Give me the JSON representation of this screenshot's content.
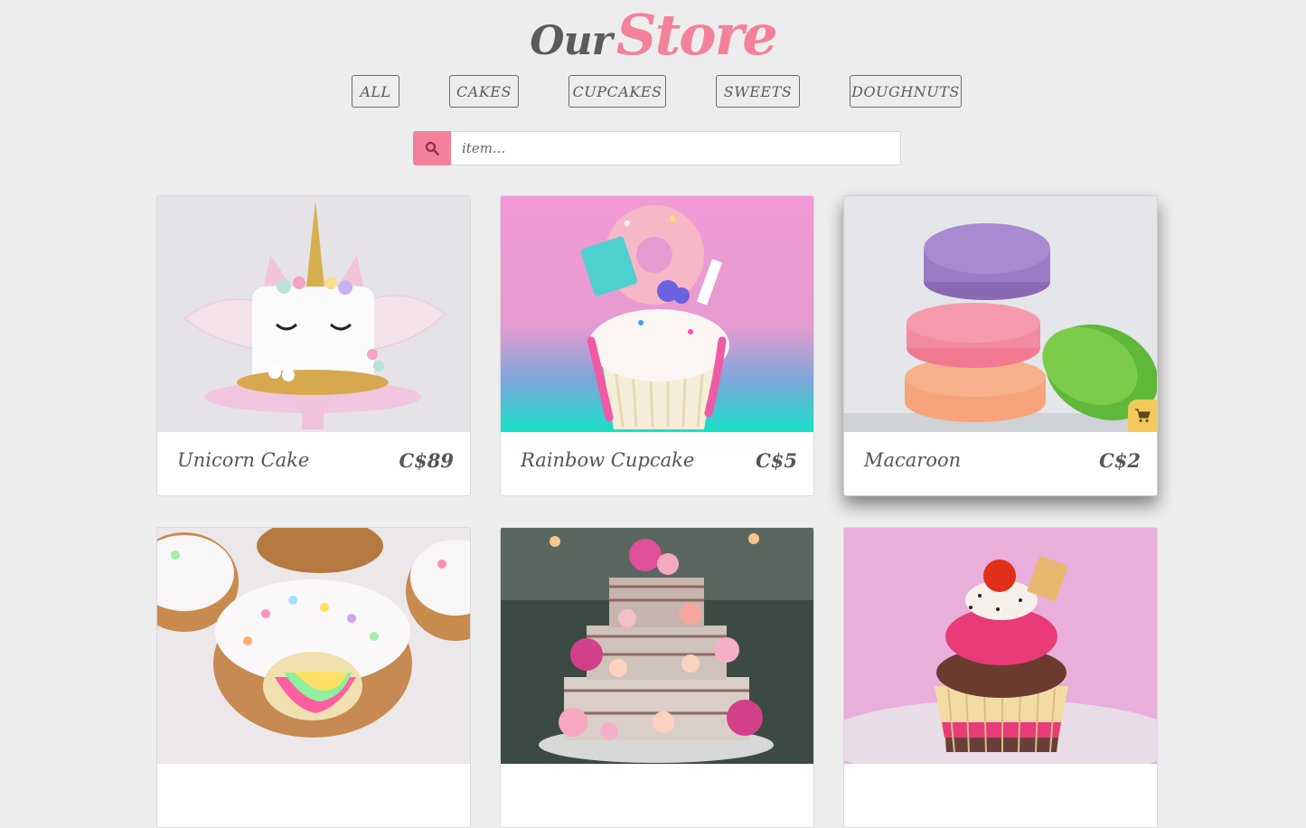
{
  "header": {
    "title_our": "Our",
    "title_store": "Store"
  },
  "filters": [
    {
      "label": "ALL"
    },
    {
      "label": "CAKES"
    },
    {
      "label": "CUPCAKES"
    },
    {
      "label": "SWEETS"
    },
    {
      "label": "DOUGHNUTS"
    }
  ],
  "search": {
    "placeholder": "item...",
    "icon": "search-icon"
  },
  "products": [
    {
      "name": "Unicorn Cake",
      "price": "C$89"
    },
    {
      "name": "Rainbow Cupcake",
      "price": "C$5"
    },
    {
      "name": "Macaroon",
      "price": "C$2",
      "cart_icon": "cart-icon"
    },
    {
      "name": "",
      "price": ""
    },
    {
      "name": "",
      "price": ""
    },
    {
      "name": "",
      "price": ""
    }
  ],
  "colors": {
    "accent": "#f4819a",
    "cart_badge": "#f3c95b",
    "text": "#555555",
    "background": "#ededed"
  }
}
